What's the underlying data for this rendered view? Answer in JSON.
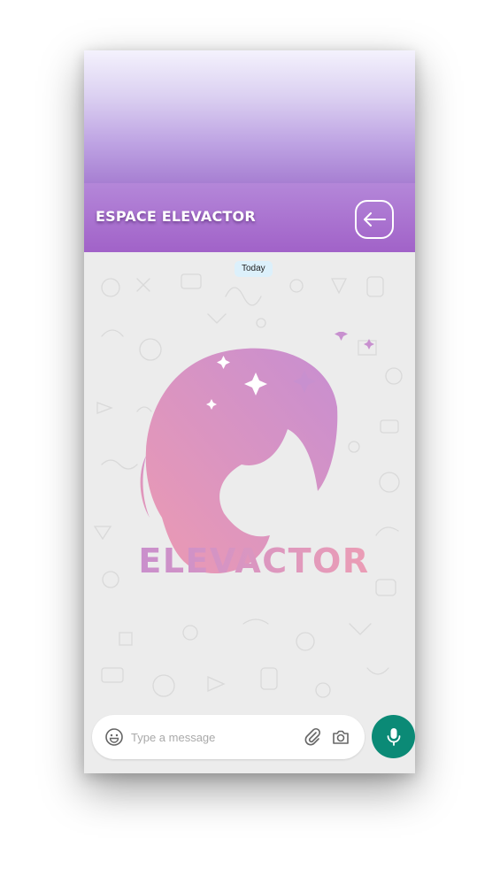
{
  "header": {
    "title": "ESPACE ELEVACTOR",
    "back_icon": "arrow-left-icon"
  },
  "chat": {
    "date_label": "Today",
    "logo_text": "ELEVACTOR"
  },
  "composer": {
    "placeholder": "Type a message",
    "emoji_icon": "emoji-icon",
    "attach_icon": "paperclip-icon",
    "camera_icon": "camera-icon",
    "mic_icon": "microphone-icon"
  },
  "colors": {
    "header_purple": "#a162c8",
    "mic_button": "#0b8a76",
    "logo_pink": "#e58fb0",
    "logo_violet": "#c58dd0",
    "date_chip": "#dcf0fb"
  }
}
